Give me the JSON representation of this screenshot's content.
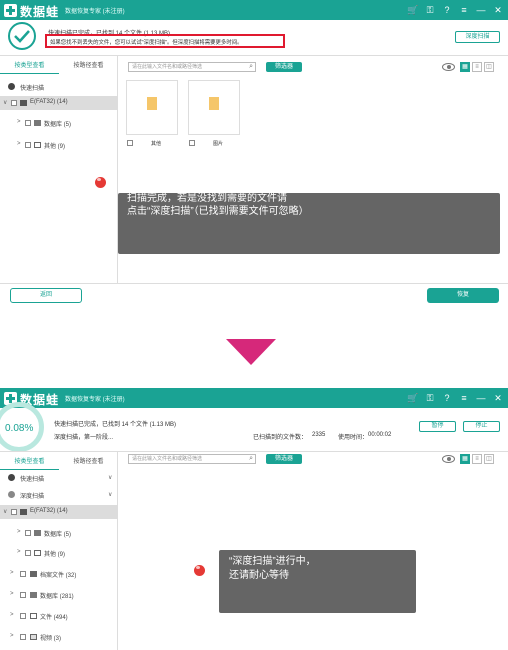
{
  "app": {
    "logo": "数据蛙",
    "subtitle": "数据恢复专家 (未注册)"
  },
  "top": {
    "status_line": "快速扫描已完成，已找到 14 个文件 (1.13 MB)",
    "notice_line": "如果您找不到丢失的文件，您可以试试\"深度扫描\"。但深度扫描将需要更多时间。",
    "deep_scan_button": "深度扫描",
    "tabs": [
      "按类型查看",
      "按路径查看"
    ],
    "search_placeholder": "请在此输入文件名和或路径筛选",
    "filter_button": "筛选器",
    "view_icons": [
      "grid-view-icon",
      "list-view-icon",
      "detail-view-icon"
    ],
    "tree": [
      {
        "label": "快速扫描"
      },
      {
        "label": "E(FAT32) (14)"
      },
      {
        "label": "数据库 (5)"
      },
      {
        "label": "其他 (9)"
      }
    ],
    "files": [
      {
        "name": "其他"
      },
      {
        "name": "图片"
      }
    ],
    "tooltip_lines": [
      "扫描完成，若是没找到需要的文件请",
      "点击“深度扫描”（已找到需要文件可忽略）"
    ],
    "back_button": "返回",
    "recover_button": "恢复"
  },
  "bottom": {
    "progress": "0.08%",
    "status_line": "快速扫描已完成，已找到 14 个文件 (1.13 MB)",
    "phase_line": "深度扫描，第一阶段...",
    "scanned_label": "已扫描到的文件数：",
    "scanned_count": "2335",
    "time_label": "使用时间：",
    "time_value": "00:00:02",
    "pause_button": "暂停",
    "stop_button": "停止",
    "tabs": [
      "按类型查看",
      "按路径查看"
    ],
    "search_placeholder": "请在此输入文件名和或路径筛选",
    "filter_button": "筛选器",
    "view_icons": [
      "grid-view-icon",
      "list-view-icon",
      "detail-view-icon"
    ],
    "tree": [
      {
        "label": "快速扫描"
      },
      {
        "label": "深度扫描"
      },
      {
        "label": "E(FAT32) (14)"
      },
      {
        "label": "数据库 (5)"
      },
      {
        "label": "其他 (9)"
      },
      {
        "label": "档案文件 (32)"
      },
      {
        "label": "数据库 (281)"
      },
      {
        "label": "文件 (494)"
      },
      {
        "label": "视频 (3)"
      }
    ],
    "tooltip_lines": [
      "“深度扫描”进行中，",
      "还请耐心等待"
    ]
  },
  "colors": {
    "brand": "#1aa394",
    "highlight_border": "#e0192f",
    "arrow": "#d6287a",
    "tooltip": "#656565",
    "red_dot": "#e53935"
  }
}
